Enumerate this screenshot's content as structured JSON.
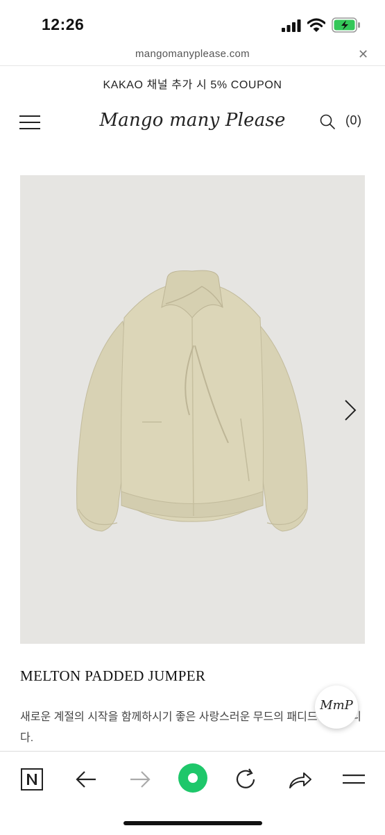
{
  "status_bar": {
    "time": "12:26"
  },
  "browser": {
    "url": "mangomanyplease.com",
    "close_glyph": "✕"
  },
  "promo": {
    "text": "KAKAO 채널 추가 시 5% COUPON"
  },
  "header": {
    "logo": "Mango many Please",
    "cart": "(0)"
  },
  "product": {
    "title": "MELTON PADDED JUMPER",
    "description": "새로운 계절의 시작을 함께하시기 좋은 사랑스러운 무드의 패디드 점퍼입니다.",
    "image_bg": "#e6e5e2",
    "jacket_color": "#d8d2b4"
  },
  "badge": {
    "text": "MmP"
  },
  "toolbar": {
    "items": [
      "naver-icon",
      "back-arrow-icon",
      "forward-arrow-icon",
      "green-circle-icon",
      "reload-icon",
      "share-icon",
      "menu-icon"
    ],
    "accent": "#1ec76a"
  }
}
